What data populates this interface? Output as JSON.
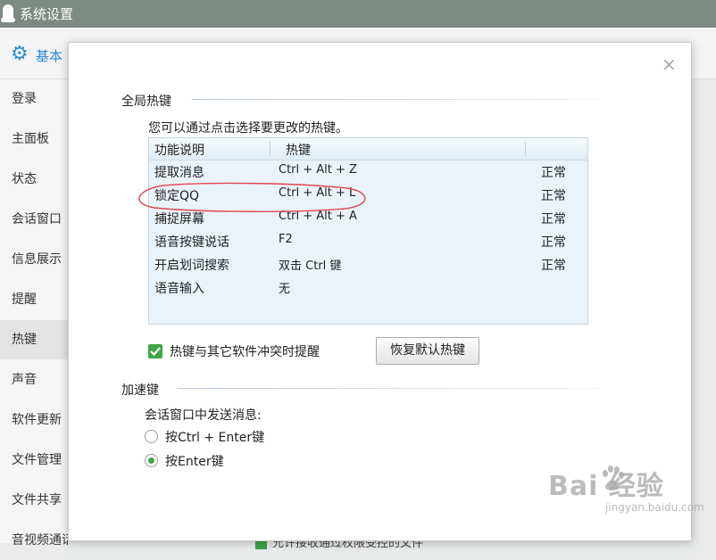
{
  "window": {
    "title": "系统设置"
  },
  "toolbar": {
    "tab_label": "基本"
  },
  "sidebar": {
    "items": [
      {
        "label": "登录"
      },
      {
        "label": "主面板"
      },
      {
        "label": "状态"
      },
      {
        "label": "会话窗口"
      },
      {
        "label": "信息展示"
      },
      {
        "label": "提醒"
      },
      {
        "label": "热键"
      },
      {
        "label": "声音"
      },
      {
        "label": "软件更新"
      },
      {
        "label": "文件管理"
      },
      {
        "label": "文件共享"
      },
      {
        "label": "音视频通话"
      }
    ],
    "active_item": "热键"
  },
  "background_bottom": {
    "text": "允许接收通过权限受控的文件"
  },
  "dialog": {
    "close_label": "×",
    "global_hotkeys": {
      "section_title": "全局热键",
      "hint": "您可以通过点击选择要更改的热键。",
      "columns": [
        "功能说明",
        "热键",
        ""
      ],
      "rows": [
        {
          "function": "提取消息",
          "hotkey": "Ctrl + Alt + Z",
          "status": "正常"
        },
        {
          "function": "锁定QQ",
          "hotkey": "Ctrl + Alt + L",
          "status": "正常"
        },
        {
          "function": "捕捉屏幕",
          "hotkey": "Ctrl + Alt + A",
          "status": "正常"
        },
        {
          "function": "语音按键说话",
          "hotkey": "F2",
          "status": "正常"
        },
        {
          "function": "开启划词搜索",
          "hotkey": "双击 Ctrl 键",
          "status": "正常"
        },
        {
          "function": "语音输入",
          "hotkey": "无",
          "status": ""
        }
      ],
      "conflict_checkbox": {
        "label": "热键与其它软件冲突时提醒",
        "checked": true
      },
      "restore_button": "恢复默认热键"
    },
    "accelerator": {
      "section_title": "加速键",
      "question": "会话窗口中发送消息:",
      "options": [
        {
          "label": "按Ctrl + Enter键",
          "selected": false
        },
        {
          "label": "按Enter键",
          "selected": true
        }
      ]
    }
  },
  "watermark": {
    "main": "Bai  经验",
    "sub": "jingyan.baidu.com"
  },
  "colors": {
    "titlebar": "#7c8a82",
    "accent": "#2b8bd6",
    "check_green": "#3fa548",
    "annotation_red": "#e0474f"
  }
}
